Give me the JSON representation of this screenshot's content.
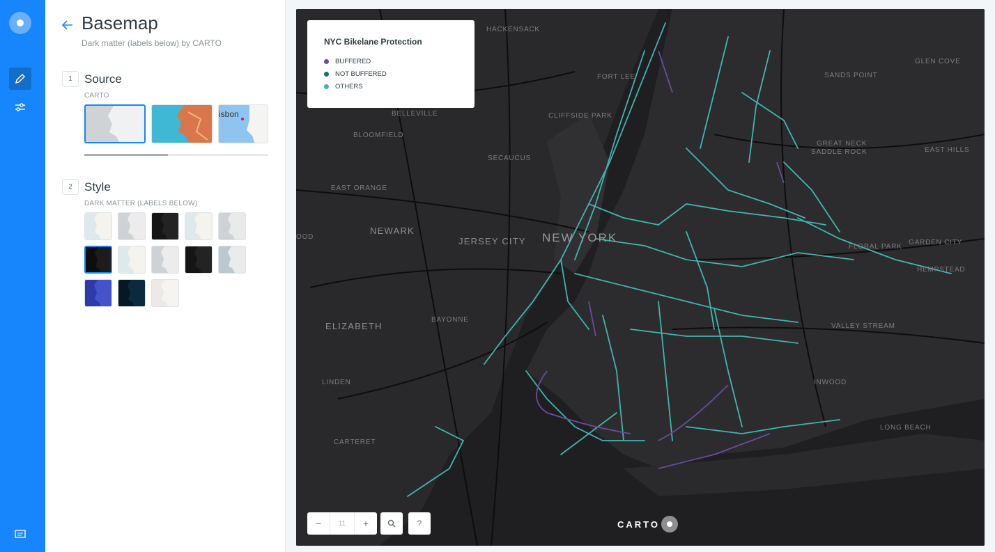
{
  "panel": {
    "title": "Basemap",
    "subtitle": "Dark matter (labels below) by CARTO",
    "source": {
      "step": "1",
      "title": "Source",
      "label": "CARTO",
      "lisbon_text": "isbon"
    },
    "style": {
      "step": "2",
      "title": "Style",
      "label": "DARK MATTER (LABELS BELOW)"
    }
  },
  "map": {
    "legend": {
      "title": "NYC Bikelane Protection",
      "items": [
        {
          "label": "BUFFERED",
          "color": "#6b4c9a"
        },
        {
          "label": "NOT BUFFERED",
          "color": "#1f6c7a"
        },
        {
          "label": "OTHERS",
          "color": "#41b5ad"
        }
      ]
    },
    "zoom_level": "11",
    "zoom_out": "−",
    "zoom_in": "+",
    "help": "?",
    "attribution": "CARTO",
    "labels": {
      "hackensack": "HACKENSACK",
      "fort_lee": "FORT LEE",
      "sands_point": "SANDS POINT",
      "glen_cove": "GLEN COVE",
      "cliffside": "CLIFFSIDE PARK",
      "bloomfield": "BLOOMFIELD",
      "belleville": "BELLEVILLE",
      "secaucus": "SECAUCUS",
      "great_neck": "GREAT NECK",
      "saddle_rock": "SADDLE ROCK",
      "east_hills": "EAST HILLS",
      "east_orange": "EAST ORANGE",
      "newark": "NEWARK",
      "jersey_city": "JERSEY CITY",
      "new_york": "NEW YORK",
      "ood": "OOD",
      "floral_park": "FLORAL PARK",
      "garden_city": "GARDEN CITY",
      "hempstead": "HEMPSTEAD",
      "elizabeth": "ELIZABETH",
      "bayonne": "BAYONNE",
      "valley_stream": "VALLEY STREAM",
      "linden": "LINDEN",
      "inwood": "INWOOD",
      "carteret": "CARTERET",
      "long_beach": "LONG BEACH"
    }
  },
  "colors": {
    "accent": "#1785fb",
    "map_bg": "#1f1f21",
    "bikelane": "#41b5ad"
  }
}
